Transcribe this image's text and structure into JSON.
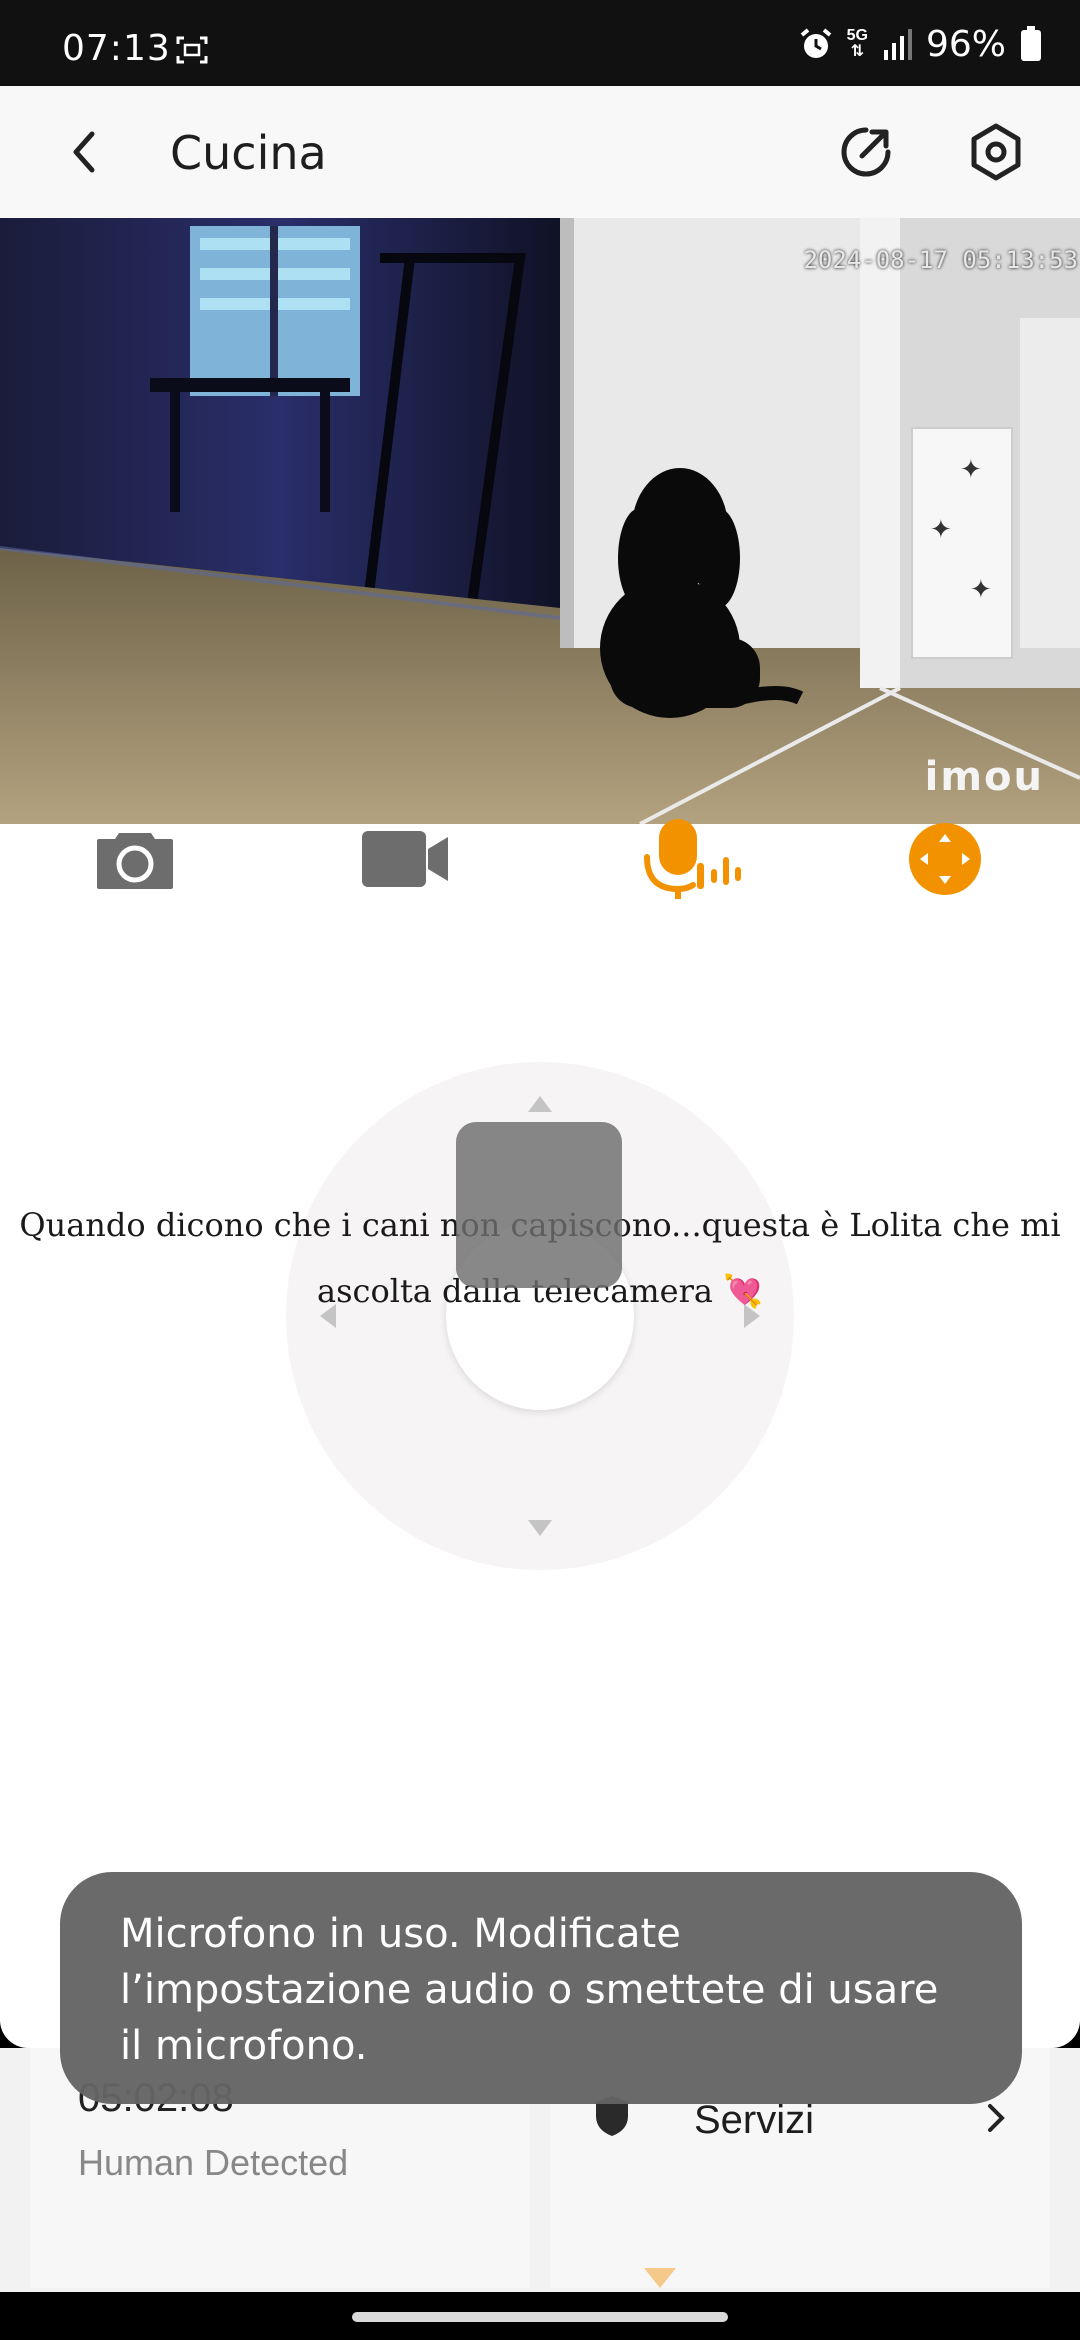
{
  "status_bar": {
    "time": "07:13",
    "network": "5G",
    "battery": "96%"
  },
  "header": {
    "title": "Cucina"
  },
  "video": {
    "timestamp": "2024-08-17 05:13:53",
    "logo": "imou"
  },
  "controls": {
    "items": [
      "camera-icon",
      "video-record-icon",
      "talk-icon",
      "ptz-icon"
    ],
    "accent_color": "#f39200",
    "icon_color": "#6d6d6d"
  },
  "caption": {
    "line1": "Quando dicono che i cani non capiscono...questa è Lolita che mi",
    "line2": "ascolta dalla telecamera 💘"
  },
  "cards": {
    "time": "05:02:08",
    "detect": "Human Detected",
    "services": "Servizi"
  },
  "toast": {
    "message": "Microfono in uso. Modificate l’impostazione audio o smettete di usare il microfono."
  }
}
